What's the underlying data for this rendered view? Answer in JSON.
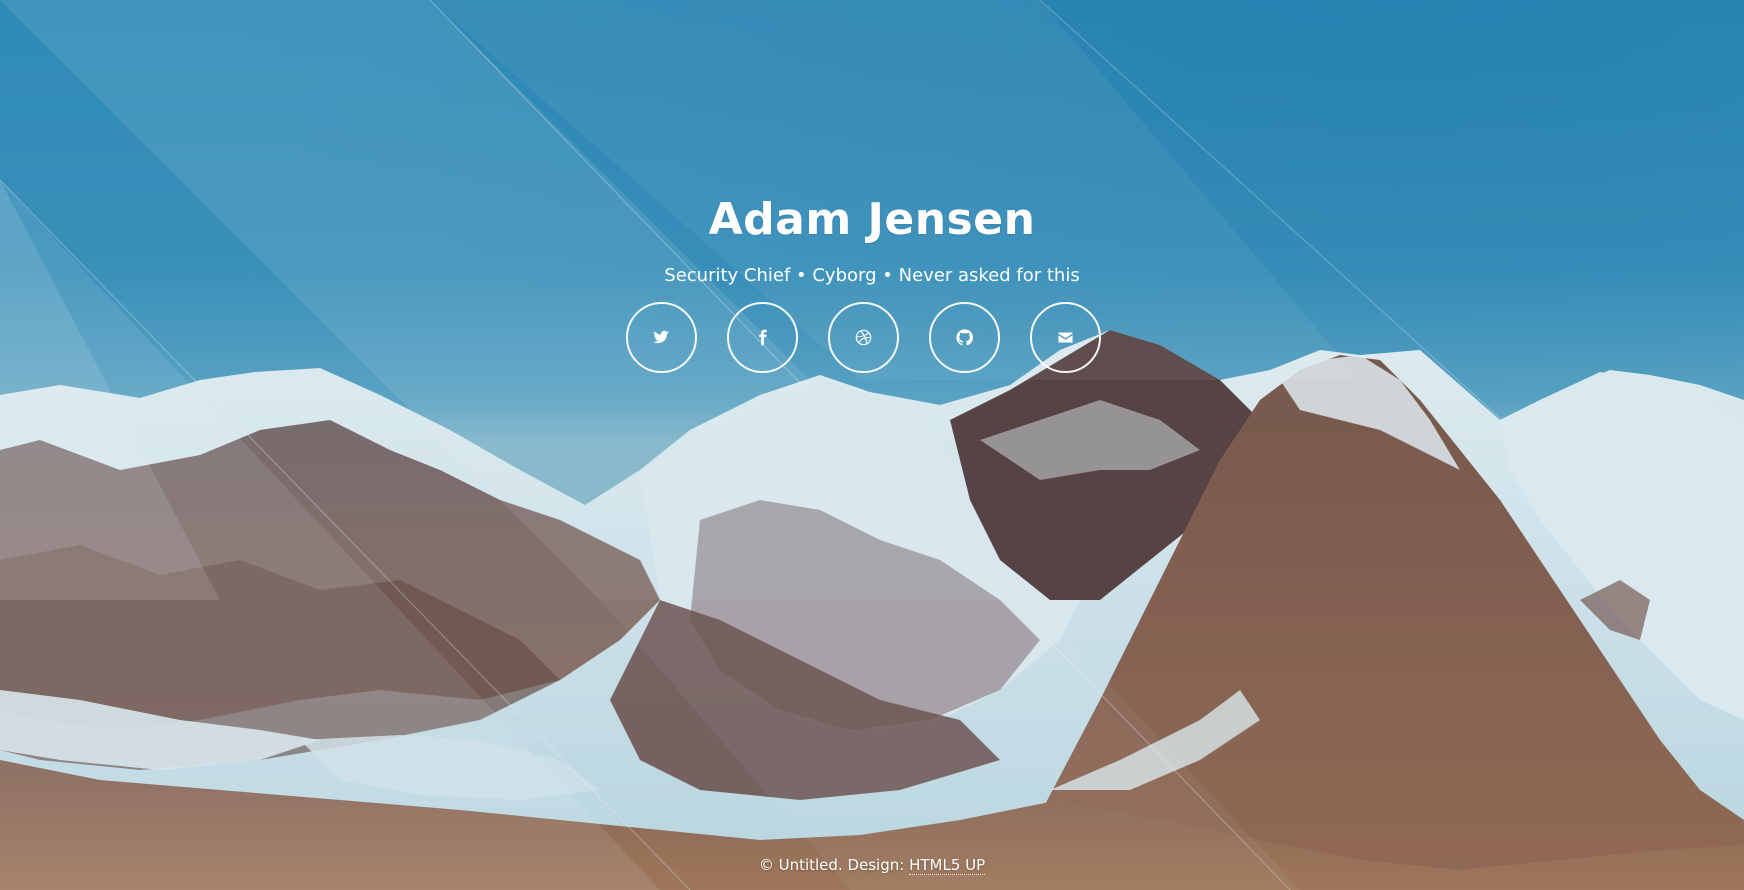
{
  "profile": {
    "name": "Adam Jensen",
    "tagline": "Security Chief • Cyborg • Never asked for this"
  },
  "social": [
    {
      "icon": "twitter-icon"
    },
    {
      "icon": "facebook-icon"
    },
    {
      "icon": "dribbble-icon"
    },
    {
      "icon": "github-icon"
    },
    {
      "icon": "envelope-icon"
    }
  ],
  "footer": {
    "copyright": "© Untitled. Design: ",
    "link_label": "HTML5 UP"
  }
}
